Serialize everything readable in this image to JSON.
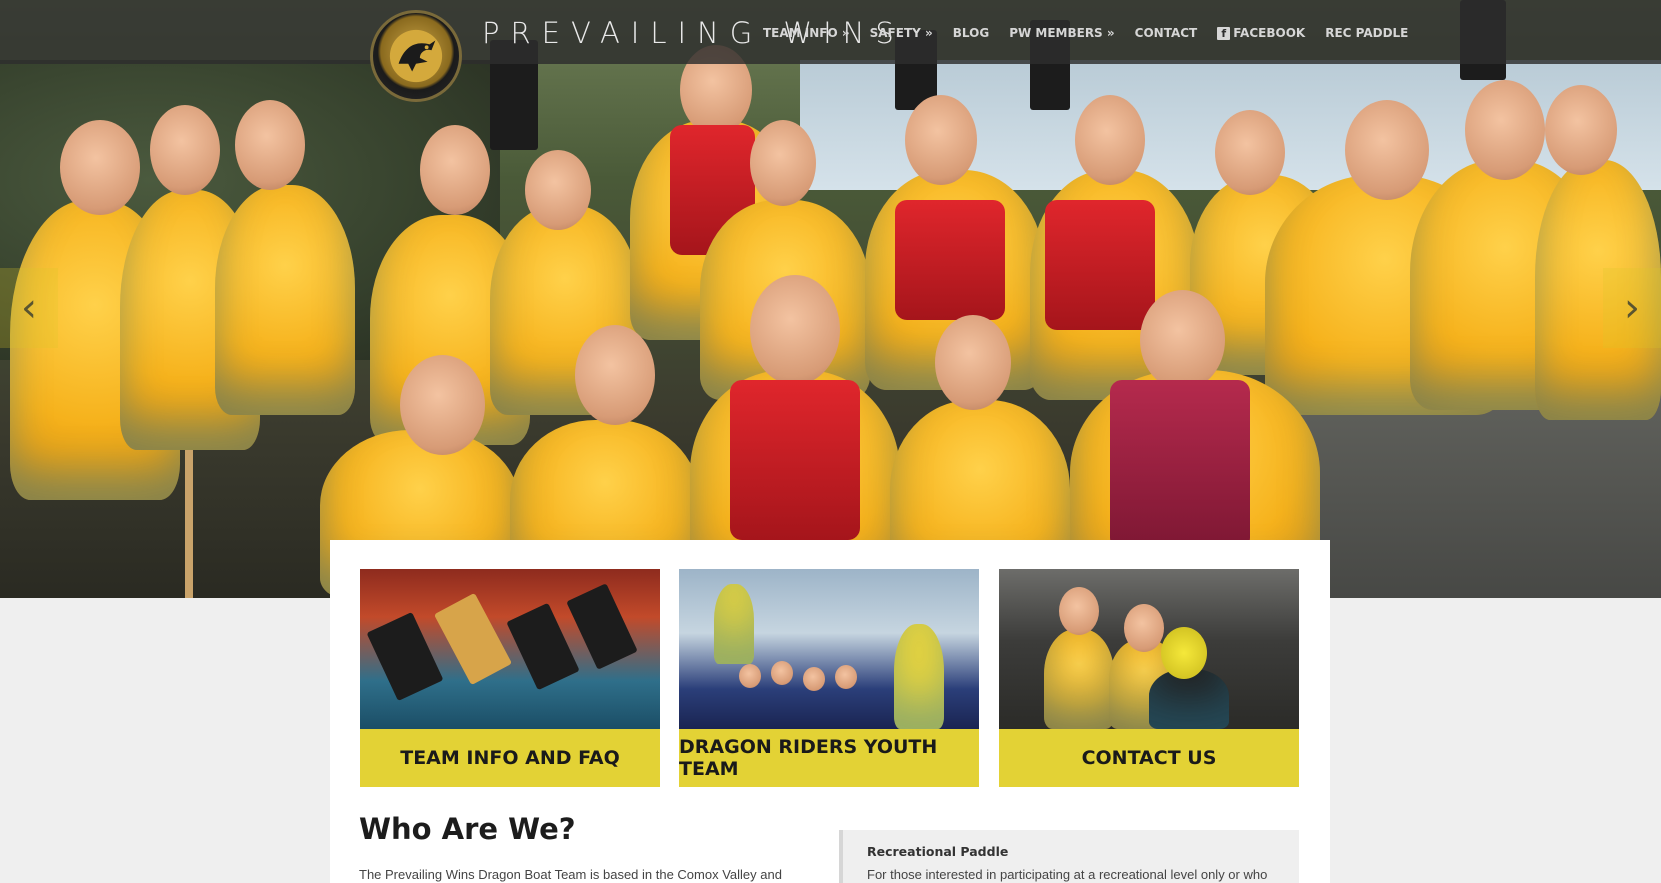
{
  "site": {
    "title": "PREVAILING WINS",
    "brand_color": "#e3d235"
  },
  "nav": {
    "items": [
      {
        "label": "TEAM INFO »"
      },
      {
        "label": "SAFETY »"
      },
      {
        "label": "BLOG"
      },
      {
        "label": "PW MEMBERS »"
      },
      {
        "label": "CONTACT"
      },
      {
        "label": "FACEBOOK",
        "icon": "facebook-icon"
      },
      {
        "label": "REC PADDLE"
      }
    ]
  },
  "slider": {
    "prev_icon": "chevron-left-icon",
    "next_icon": "chevron-right-icon",
    "prev_glyph": "‹",
    "next_glyph": "›"
  },
  "cards": [
    {
      "label": "TEAM INFO AND FAQ"
    },
    {
      "label": "DRAGON RIDERS YOUTH TEAM"
    },
    {
      "label": "CONTACT US"
    }
  ],
  "about": {
    "title": "Who Are We?",
    "text": "The Prevailing Wins Dragon Boat Team is based in the Comox Valley and"
  },
  "rec_paddle": {
    "title": "Recreational Paddle",
    "text": "For those interested in participating at a recreational level only or who"
  }
}
